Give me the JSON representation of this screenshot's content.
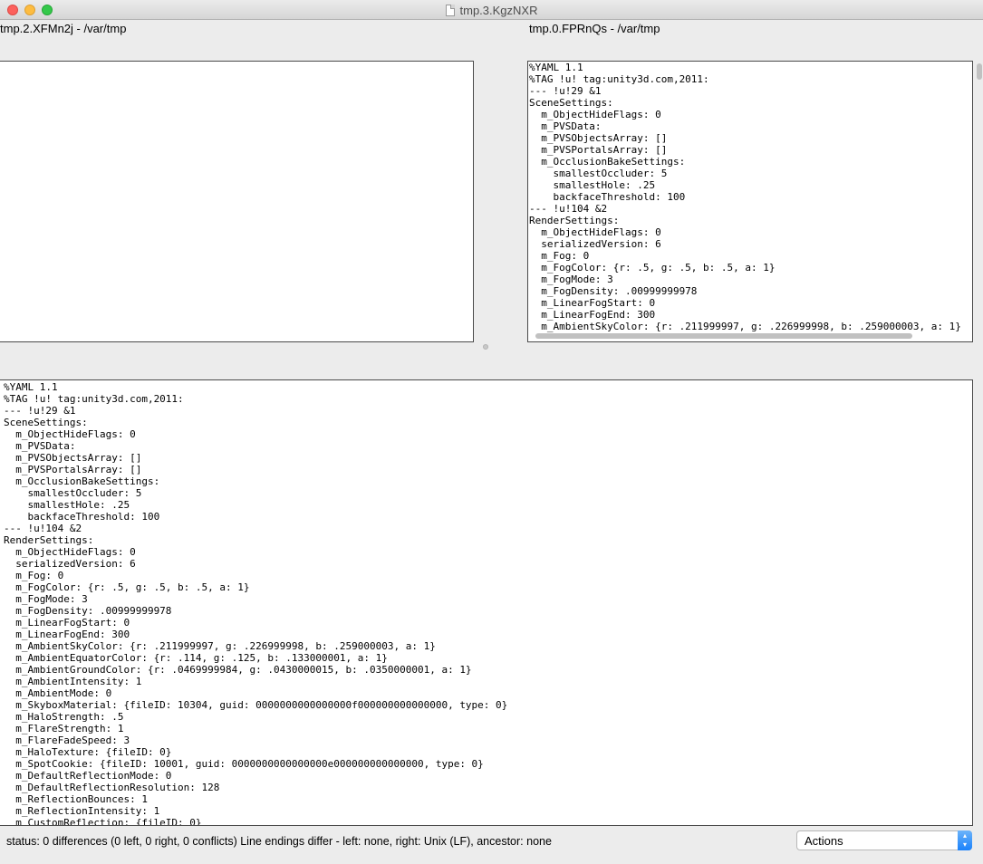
{
  "window": {
    "title": "tmp.3.KgzNXR"
  },
  "left_pane": {
    "label": "tmp.2.XFMn2j - /var/tmp"
  },
  "right_pane": {
    "label": "tmp.0.FPRnQs - /var/tmp",
    "lines": [
      "%YAML 1.1",
      "%TAG !u! tag:unity3d.com,2011:",
      "--- !u!29 &1",
      "SceneSettings:",
      "  m_ObjectHideFlags: 0",
      "  m_PVSData:",
      "  m_PVSObjectsArray: []",
      "  m_PVSPortalsArray: []",
      "  m_OcclusionBakeSettings:",
      "    smallestOccluder: 5",
      "    smallestHole: .25",
      "    backfaceThreshold: 100",
      "--- !u!104 &2",
      "RenderSettings:",
      "  m_ObjectHideFlags: 0",
      "  serializedVersion: 6",
      "  m_Fog: 0",
      "  m_FogColor: {r: .5, g: .5, b: .5, a: 1}",
      "  m_FogMode: 3",
      "  m_FogDensity: .00999999978",
      "  m_LinearFogStart: 0",
      "  m_LinearFogEnd: 300",
      "  m_AmbientSkyColor: {r: .211999997, g: .226999998, b: .259000003, a: 1}"
    ]
  },
  "bottom_pane": {
    "lines": [
      "%YAML 1.1",
      "%TAG !u! tag:unity3d.com,2011:",
      "--- !u!29 &1",
      "SceneSettings:",
      "  m_ObjectHideFlags: 0",
      "  m_PVSData:",
      "  m_PVSObjectsArray: []",
      "  m_PVSPortalsArray: []",
      "  m_OcclusionBakeSettings:",
      "    smallestOccluder: 5",
      "    smallestHole: .25",
      "    backfaceThreshold: 100",
      "--- !u!104 &2",
      "RenderSettings:",
      "  m_ObjectHideFlags: 0",
      "  serializedVersion: 6",
      "  m_Fog: 0",
      "  m_FogColor: {r: .5, g: .5, b: .5, a: 1}",
      "  m_FogMode: 3",
      "  m_FogDensity: .00999999978",
      "  m_LinearFogStart: 0",
      "  m_LinearFogEnd: 300",
      "  m_AmbientSkyColor: {r: .211999997, g: .226999998, b: .259000003, a: 1}",
      "  m_AmbientEquatorColor: {r: .114, g: .125, b: .133000001, a: 1}",
      "  m_AmbientGroundColor: {r: .0469999984, g: .0430000015, b: .0350000001, a: 1}",
      "  m_AmbientIntensity: 1",
      "  m_AmbientMode: 0",
      "  m_SkyboxMaterial: {fileID: 10304, guid: 0000000000000000f000000000000000, type: 0}",
      "  m_HaloStrength: .5",
      "  m_FlareStrength: 1",
      "  m_FlareFadeSpeed: 3",
      "  m_HaloTexture: {fileID: 0}",
      "  m_SpotCookie: {fileID: 10001, guid: 0000000000000000e000000000000000, type: 0}",
      "  m_DefaultReflectionMode: 0",
      "  m_DefaultReflectionResolution: 128",
      "  m_ReflectionBounces: 1",
      "  m_ReflectionIntensity: 1",
      "  m_CustomReflection: {fileID: 0}"
    ]
  },
  "status": {
    "text": "status: 0 differences  (0 left,  0 right,  0 conflicts)   Line endings differ - left: none,  right: Unix (LF),  ancestor: none"
  },
  "actions_select": {
    "value": "Actions"
  }
}
